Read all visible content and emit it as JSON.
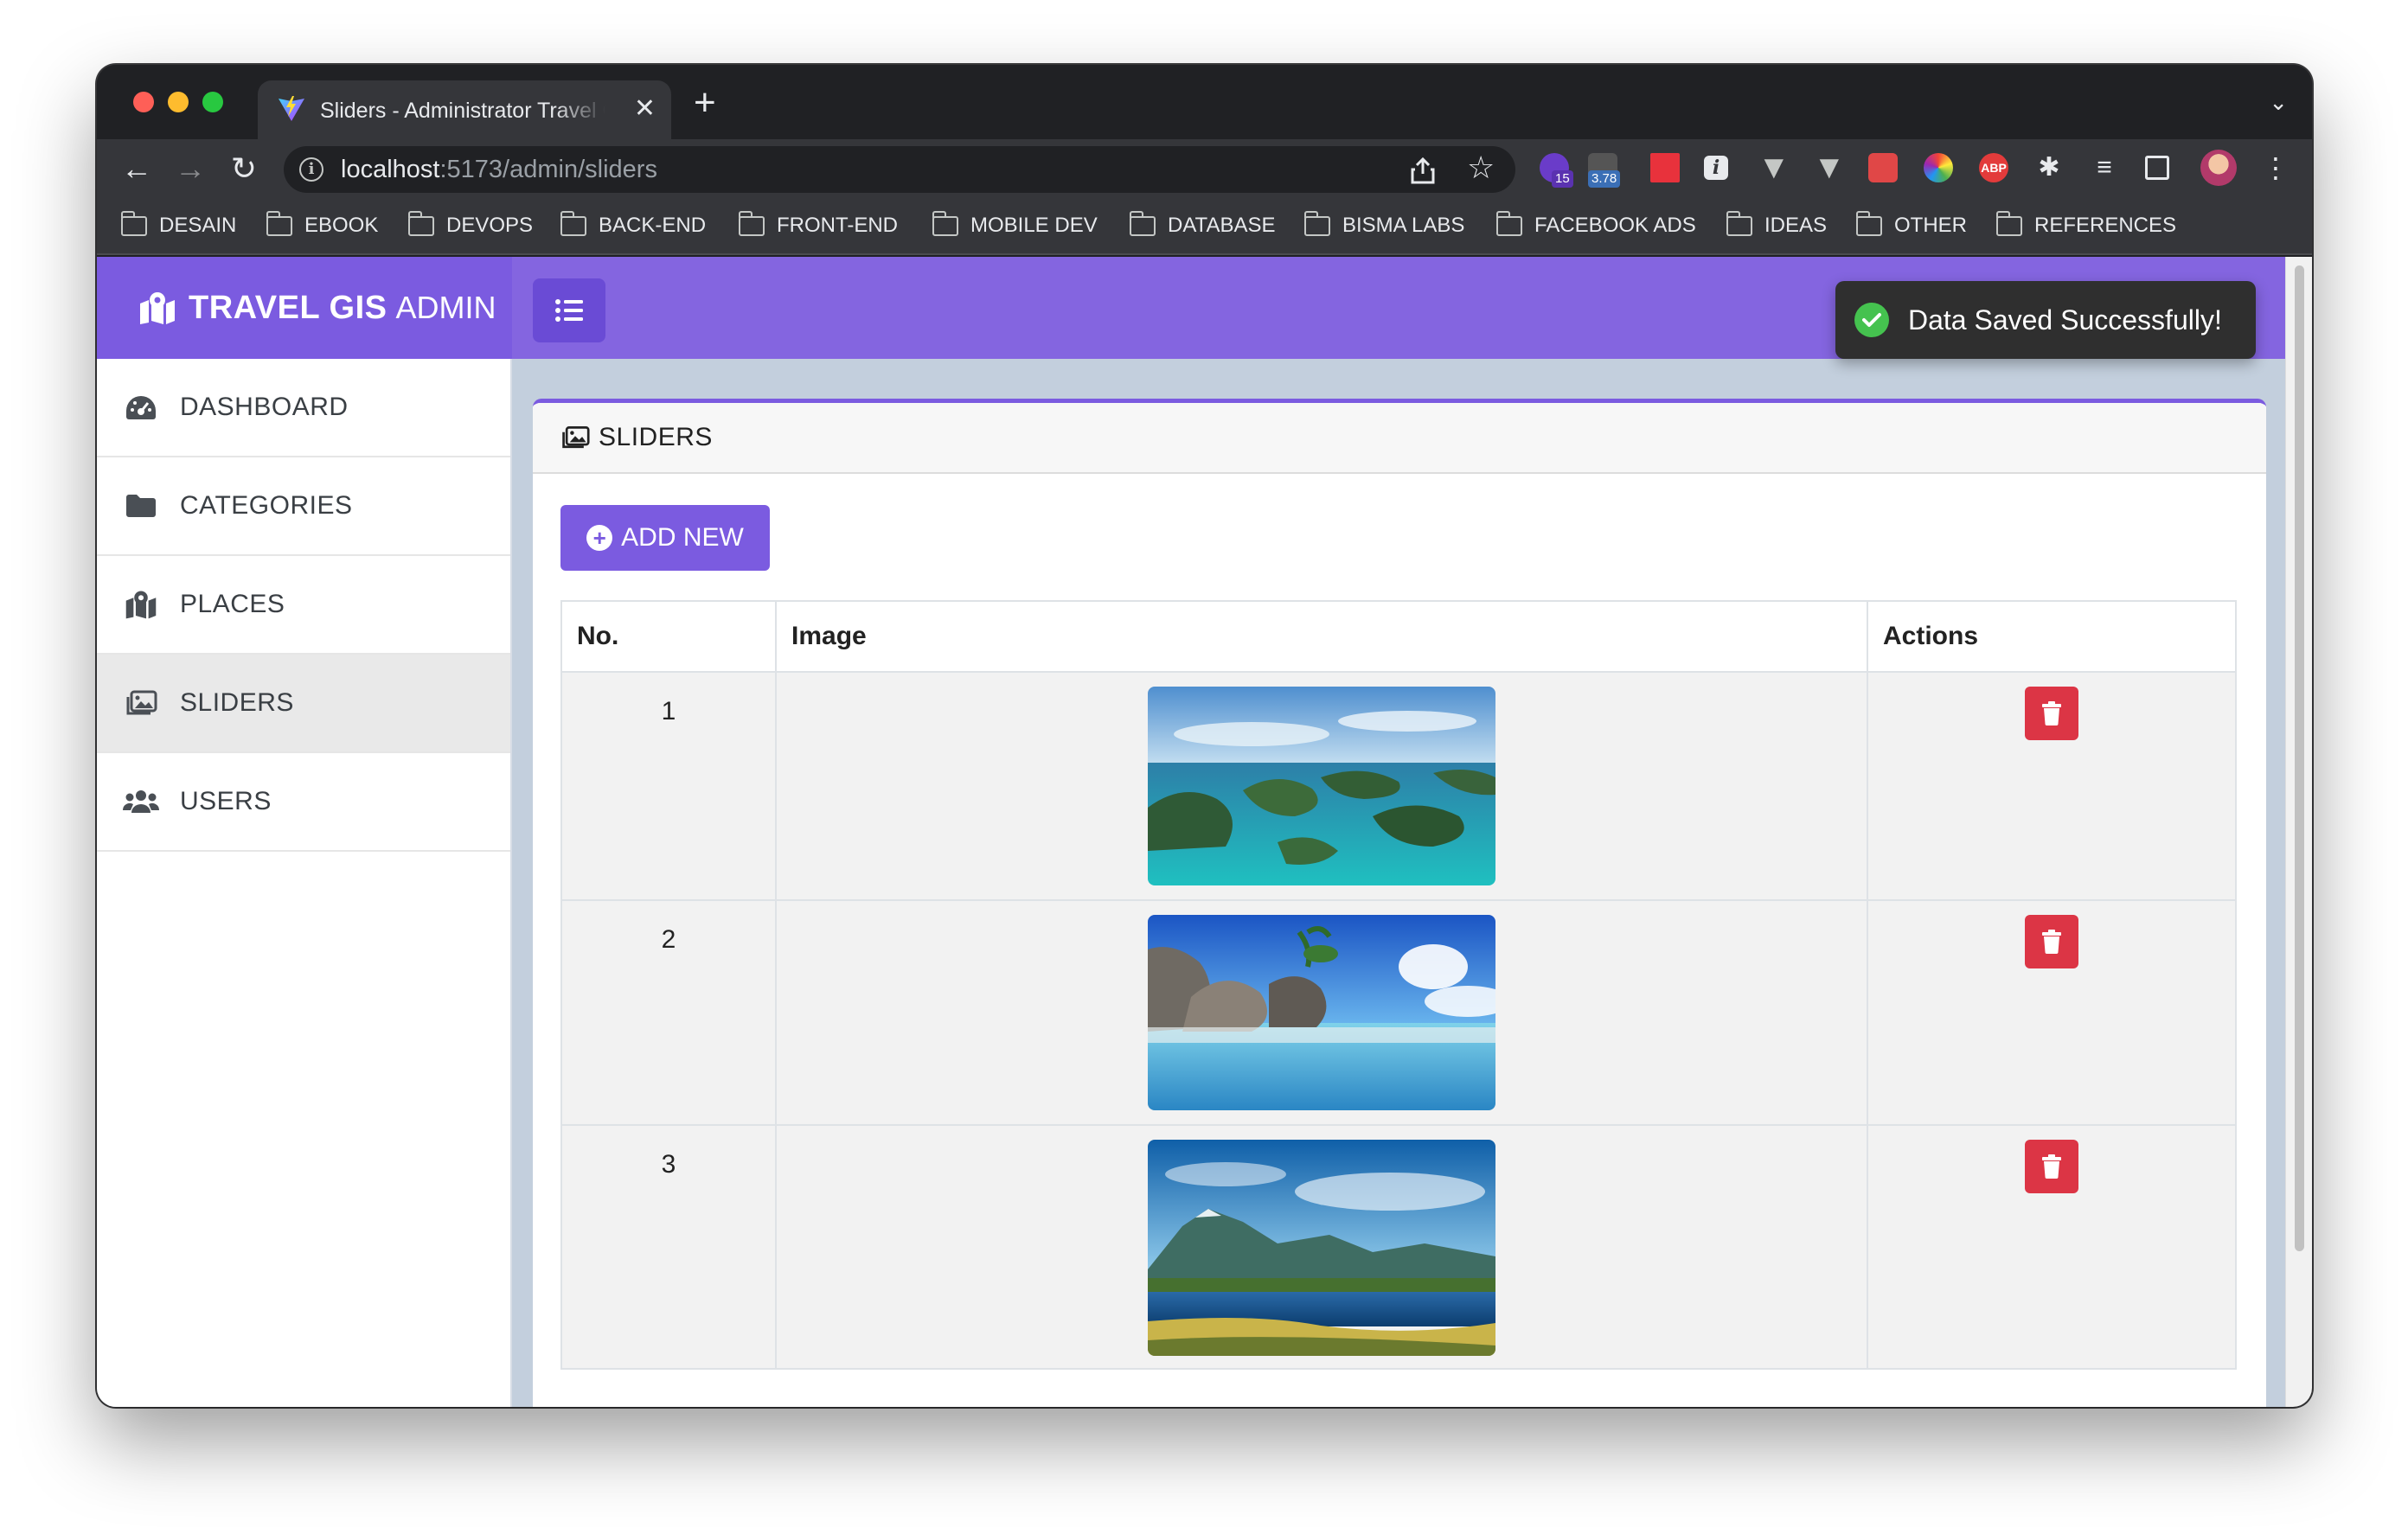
{
  "browser": {
    "tab_title": "Sliders - Administrator Travel GIS",
    "tab_close": "✕",
    "new_tab": "+",
    "url_host": "localhost",
    "url_path": ":5173/admin/sliders",
    "extensions": {
      "badge_1": "15",
      "badge_2": "3.78",
      "abp": "ABP"
    },
    "bookmarks": [
      "DESAIN",
      "EBOOK",
      "DEVOPS",
      "BACK-END",
      "FRONT-END",
      "MOBILE DEV",
      "DATABASE",
      "BISMA LABS",
      "FACEBOOK ADS",
      "IDEAS",
      "OTHER",
      "REFERENCES"
    ]
  },
  "app": {
    "brand_title": "TRAVEL GIS",
    "brand_sub": "ADMIN",
    "accent_color": "#7b5be0",
    "sidebar": [
      {
        "label": "DASHBOARD",
        "icon": "tachometer-icon"
      },
      {
        "label": "CATEGORIES",
        "icon": "folder-icon"
      },
      {
        "label": "PLACES",
        "icon": "map-marked-icon"
      },
      {
        "label": "SLIDERS",
        "icon": "images-icon",
        "active": true
      },
      {
        "label": "USERS",
        "icon": "users-icon"
      }
    ],
    "card_title": "SLIDERS",
    "add_button": "ADD NEW",
    "table": {
      "headers": [
        "No.",
        "Image",
        "Actions"
      ],
      "rows": [
        {
          "no": "1",
          "image": "tropical-islands-lagoon"
        },
        {
          "no": "2",
          "image": "granite-boulder-beach"
        },
        {
          "no": "3",
          "image": "mountain-lake-landscape"
        }
      ]
    },
    "toast": "Data Saved Successfully!",
    "toast_color": "#45c24f",
    "delete_color": "#dc3545"
  }
}
